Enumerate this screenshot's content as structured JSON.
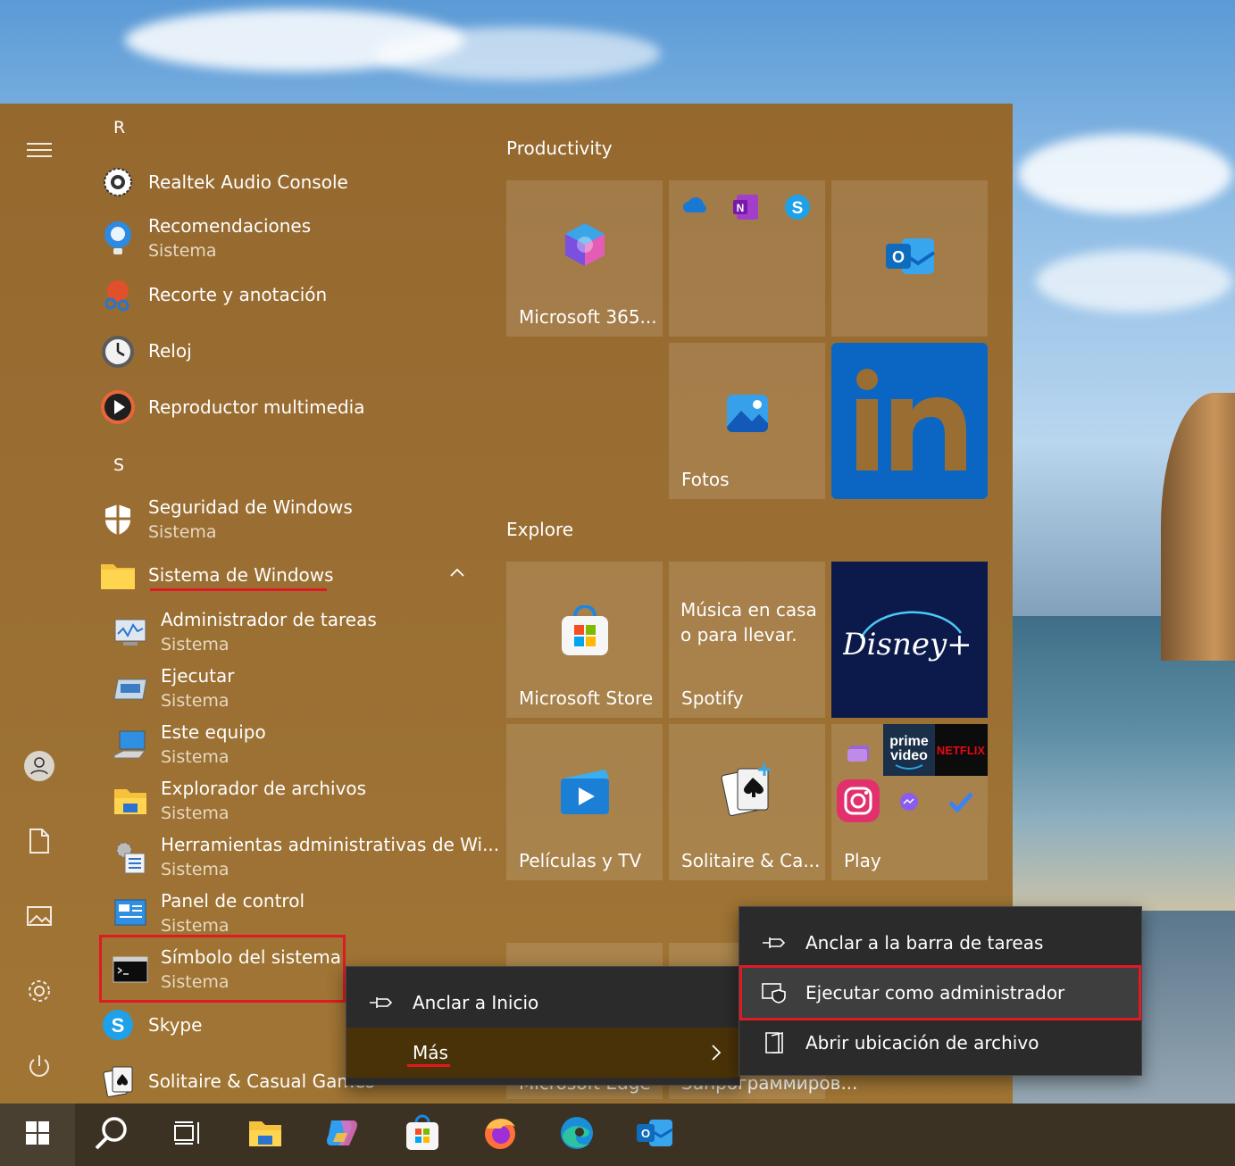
{
  "sections": {
    "r": "R",
    "s": "S"
  },
  "apps": {
    "realtek": {
      "name": "Realtek Audio Console"
    },
    "recomendaciones": {
      "name": "Recomendaciones",
      "sub": "Sistema"
    },
    "recorte": {
      "name": "Recorte y anotación"
    },
    "reloj": {
      "name": "Reloj"
    },
    "reproductor": {
      "name": "Reproductor multimedia"
    },
    "seguridad": {
      "name": "Seguridad de Windows",
      "sub": "Sistema"
    },
    "sistema_windows": {
      "name": "Sistema de Windows"
    },
    "admin_tareas": {
      "name": "Administrador de tareas",
      "sub": "Sistema"
    },
    "ejecutar": {
      "name": "Ejecutar",
      "sub": "Sistema"
    },
    "este_equipo": {
      "name": "Este equipo",
      "sub": "Sistema"
    },
    "explorador": {
      "name": "Explorador de archivos",
      "sub": "Sistema"
    },
    "herramientas": {
      "name": "Herramientas administrativas de Wi...",
      "sub": "Sistema"
    },
    "panel": {
      "name": "Panel de control",
      "sub": "Sistema"
    },
    "simbolo": {
      "name": "Símbolo del sistema",
      "sub": "Sistema"
    },
    "skype": {
      "name": "Skype"
    },
    "solitaire": {
      "name": "Solitaire & Casual Games"
    }
  },
  "groups": {
    "productivity": "Productivity",
    "explore": "Explore"
  },
  "tiles": {
    "m365": "Microsoft 365...",
    "fotos": "Fotos",
    "store": "Microsoft Store",
    "spotify": "Spotify",
    "spotify_text": "Música en casa o para llevar.",
    "peliculas": "Películas y TV",
    "solitaire": "Solitaire & Ca...",
    "play": "Play",
    "edge_partial": "Microsoft Edge",
    "hidden_partial": "Запрограммиров..."
  },
  "context_main": {
    "pin_start": "Anclar a Inicio",
    "more": "Más"
  },
  "context_sub": {
    "pin_taskbar": "Anclar a la barra de tareas",
    "run_admin": "Ejecutar como administrador",
    "open_location": "Abrir ubicación de archivo"
  },
  "colors": {
    "highlight": "#e01a22",
    "start_bg": "#9a6e33",
    "linkedin": "#0a66c2"
  }
}
